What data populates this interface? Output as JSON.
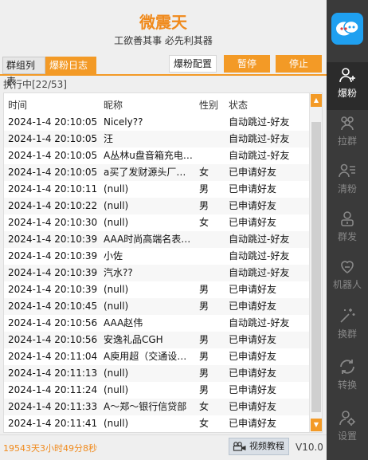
{
  "app": {
    "title": "微震天",
    "slogan": "工欲善其事  必先利其器"
  },
  "toolbar": {
    "tab_groups": "群组列表",
    "tab_log": "爆粉日志",
    "config": "爆粉配置",
    "pause": "暂停",
    "stop": "停止"
  },
  "progress": "执行中[22/53]",
  "table": {
    "headers": {
      "time": "时间",
      "nickname": "昵称",
      "gender": "性别",
      "status": "状态"
    },
    "rows": [
      {
        "time": "2024-1-4 20:10:05",
        "nickname": "Nicely??",
        "gender": "",
        "status": "自动跳过-好友"
      },
      {
        "time": "2024-1-4 20:10:05",
        "nickname": "汪",
        "gender": "",
        "status": "自动跳过-好友"
      },
      {
        "time": "2024-1-4 20:10:05",
        "nickname": "A丛林u盘音箱充电…",
        "gender": "",
        "status": "自动跳过-好友"
      },
      {
        "time": "2024-1-4 20:10:05",
        "nickname": "a买了发财源头厂…",
        "gender": "女",
        "status": "已申请好友"
      },
      {
        "time": "2024-1-4 20:10:11",
        "nickname": "(null)",
        "gender": "男",
        "status": "已申请好友"
      },
      {
        "time": "2024-1-4 20:10:22",
        "nickname": "(null)",
        "gender": "男",
        "status": "已申请好友"
      },
      {
        "time": "2024-1-4 20:10:30",
        "nickname": "(null)",
        "gender": "女",
        "status": "已申请好友"
      },
      {
        "time": "2024-1-4 20:10:39",
        "nickname": "AAA时尚高端名表…",
        "gender": "",
        "status": "自动跳过-好友"
      },
      {
        "time": "2024-1-4 20:10:39",
        "nickname": "小佐",
        "gender": "",
        "status": "自动跳过-好友"
      },
      {
        "time": "2024-1-4 20:10:39",
        "nickname": "汽水??",
        "gender": "",
        "status": "自动跳过-好友"
      },
      {
        "time": "2024-1-4 20:10:39",
        "nickname": "(null)",
        "gender": "男",
        "status": "已申请好友"
      },
      {
        "time": "2024-1-4 20:10:45",
        "nickname": "(null)",
        "gender": "男",
        "status": "已申请好友"
      },
      {
        "time": "2024-1-4 20:10:56",
        "nickname": "AAA赵伟",
        "gender": "",
        "status": "自动跳过-好友"
      },
      {
        "time": "2024-1-4 20:10:56",
        "nickname": "安逸礼品CGH",
        "gender": "男",
        "status": "已申请好友"
      },
      {
        "time": "2024-1-4 20:11:04",
        "nickname": "A庾用超（交通设…",
        "gender": "男",
        "status": "已申请好友"
      },
      {
        "time": "2024-1-4 20:11:13",
        "nickname": "(null)",
        "gender": "男",
        "status": "已申请好友"
      },
      {
        "time": "2024-1-4 20:11:24",
        "nickname": "(null)",
        "gender": "男",
        "status": "已申请好友"
      },
      {
        "time": "2024-1-4 20:11:33",
        "nickname": "A～郑～银行信贷部",
        "gender": "女",
        "status": "已申请好友"
      },
      {
        "time": "2024-1-4 20:11:41",
        "nickname": "(null)",
        "gender": "女",
        "status": "已申请好友"
      }
    ]
  },
  "footer": {
    "uptime": "19543天3小时49分8秒",
    "video_button": "视频教程",
    "version": "V10.0"
  },
  "sidebar": {
    "items": [
      {
        "label": "爆粉",
        "icon": "user-add-icon"
      },
      {
        "label": "拉群",
        "icon": "group-icon"
      },
      {
        "label": "清粉",
        "icon": "user-list-icon"
      },
      {
        "label": "群发",
        "icon": "broadcast-icon"
      },
      {
        "label": "机器人",
        "icon": "robot-icon"
      },
      {
        "label": "换群",
        "icon": "magic-wand-icon"
      },
      {
        "label": "转换",
        "icon": "refresh-icon"
      },
      {
        "label": "设置",
        "icon": "settings-icon"
      }
    ]
  },
  "colors": {
    "accent": "#f39a26",
    "sidebar_bg": "#3a3a3a",
    "logo_bg": "#1fa0f0"
  }
}
